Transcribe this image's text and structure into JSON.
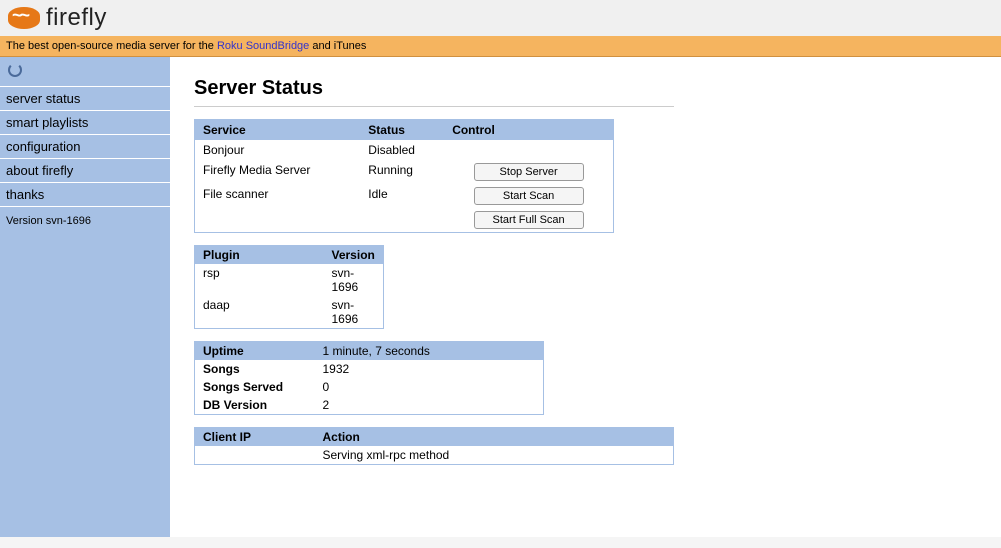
{
  "header": {
    "brand": "firefly",
    "tagline_before": "The best open-source media server for the ",
    "tagline_link": "Roku SoundBridge",
    "tagline_after": " and iTunes"
  },
  "sidebar": {
    "items": [
      {
        "label": "server status"
      },
      {
        "label": "smart playlists"
      },
      {
        "label": "configuration"
      },
      {
        "label": "about firefly"
      },
      {
        "label": "thanks"
      }
    ],
    "version": "Version svn-1696"
  },
  "page": {
    "title": "Server Status"
  },
  "services": {
    "headers": {
      "service": "Service",
      "status": "Status",
      "control": "Control"
    },
    "rows": [
      {
        "service": "Bonjour",
        "status": "Disabled",
        "control": null
      },
      {
        "service": "Firefly Media Server",
        "status": "Running",
        "control": "Stop Server"
      },
      {
        "service": "File scanner",
        "status": "Idle",
        "control": "Start Scan"
      },
      {
        "service": "",
        "status": "",
        "control": "Start Full Scan"
      }
    ]
  },
  "plugins": {
    "headers": {
      "plugin": "Plugin",
      "version": "Version"
    },
    "rows": [
      {
        "plugin": "rsp",
        "version": "svn-1696"
      },
      {
        "plugin": "daap",
        "version": "svn-1696"
      }
    ]
  },
  "stats": {
    "rows": [
      {
        "label": "Uptime",
        "value": "1 minute, 7 seconds"
      },
      {
        "label": "Songs",
        "value": "1932"
      },
      {
        "label": "Songs Served",
        "value": "0"
      },
      {
        "label": "DB Version",
        "value": "2"
      }
    ]
  },
  "clients": {
    "headers": {
      "ip": "Client IP",
      "action": "Action"
    },
    "rows": [
      {
        "ip": "",
        "action": "Serving xml-rpc method"
      }
    ]
  }
}
